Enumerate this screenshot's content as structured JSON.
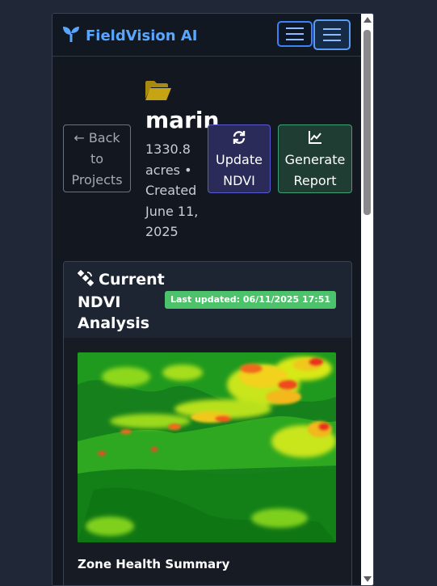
{
  "navbar": {
    "brand_name": "FieldVision AI",
    "brand_color": "#58a6ff"
  },
  "header": {
    "back_label_1": "← Back",
    "back_label_2": "to",
    "back_label_3": "Projects",
    "project_name": "marin",
    "meta": [
      "1330.8",
      "acres •",
      "Created",
      "June 11,",
      "2025"
    ],
    "update_label_1": "Update",
    "update_label_2": "NDVI",
    "report_label_1": "Generate",
    "report_label_2": "Report"
  },
  "ndvi_card": {
    "title_line1": "Current",
    "title_line2": "NDVI",
    "title_line3": "Analysis",
    "badge": "Last updated: 06/11/2025 17:51",
    "badge_color": "#4cc26a",
    "zone_title": "Zone Health Summary"
  },
  "icons": {
    "brand": "seedling-icon",
    "folder": "folder-open-icon",
    "update": "sync-icon",
    "report": "chart-line-icon",
    "satellite": "satellite-icon"
  }
}
